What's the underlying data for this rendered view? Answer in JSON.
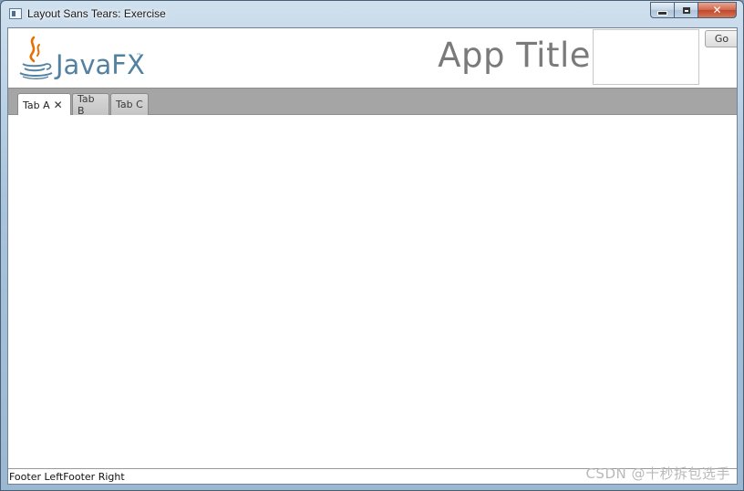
{
  "window": {
    "title": "Layout Sans Tears: Exercise",
    "controls": {
      "minimize": "",
      "maximize": "",
      "close": "✕"
    }
  },
  "header": {
    "logo_text": "JavaFX",
    "logo_tm": "™",
    "app_title": "App Title",
    "search_value": "",
    "go_label": "Go"
  },
  "tabs": [
    {
      "label": "Tab A",
      "active": true,
      "close": "✕"
    },
    {
      "label": "Tab B",
      "active": false
    },
    {
      "label": "Tab C",
      "active": false
    }
  ],
  "footer": {
    "left": "Footer Left",
    "right": "Footer Right"
  },
  "watermark": "CSDN @十秒拆包选手",
  "colors": {
    "logo_blue": "#5382a1",
    "logo_orange": "#e76f00",
    "tab_strip": "#a5a5a5",
    "title_gray": "#7a7a7a"
  }
}
